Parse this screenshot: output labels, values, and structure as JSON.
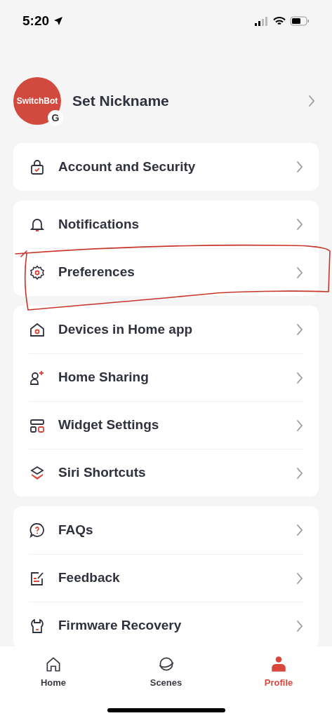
{
  "status_bar": {
    "time": "5:20"
  },
  "profile": {
    "avatar_text": "SwitchBot",
    "badge": "G",
    "nickname": "Set Nickname"
  },
  "groups": [
    {
      "items": [
        {
          "label": "Account and Security"
        }
      ]
    },
    {
      "items": [
        {
          "label": "Notifications"
        },
        {
          "label": "Preferences"
        }
      ]
    },
    {
      "items": [
        {
          "label": "Devices in Home app"
        },
        {
          "label": "Home Sharing"
        },
        {
          "label": "Widget Settings"
        },
        {
          "label": "Siri Shortcuts"
        }
      ]
    },
    {
      "items": [
        {
          "label": "FAQs"
        },
        {
          "label": "Feedback"
        },
        {
          "label": "Firmware Recovery"
        }
      ]
    }
  ],
  "tab_bar": [
    {
      "label": "Home",
      "selected": false
    },
    {
      "label": "Scenes",
      "selected": false
    },
    {
      "label": "Profile",
      "selected": true
    }
  ]
}
